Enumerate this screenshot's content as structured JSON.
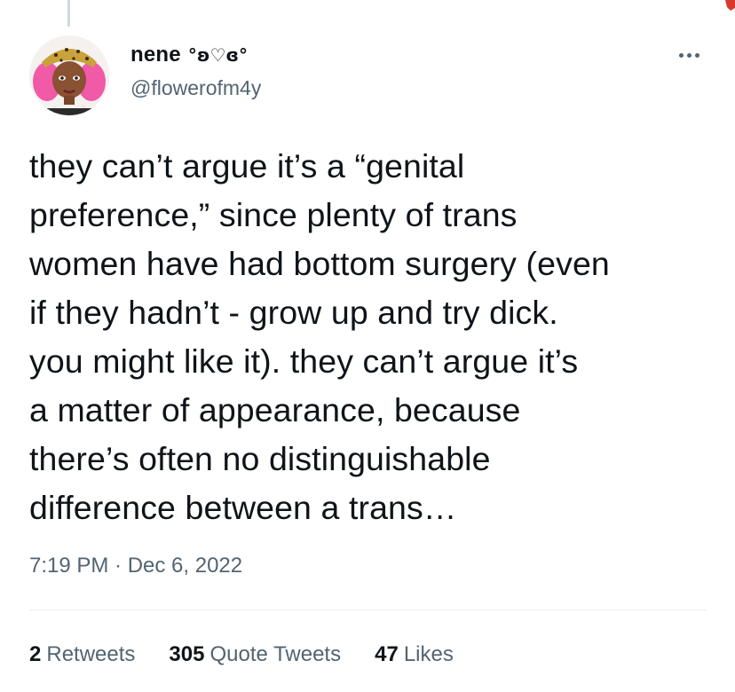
{
  "tweet": {
    "author": {
      "display_name": "nene",
      "name_decoration": "°ʚ♡ɞ°",
      "handle": "@flowerofm4y"
    },
    "text_lines": [
      "they can’t argue it’s a “genital",
      "preference,” since plenty of trans",
      "women have had bottom surgery (even",
      "if they hadn’t - grow up and try dick.",
      "you might like it). they can’t argue it’s",
      "a matter of appearance, because",
      "there’s often no distinguishable",
      "difference between a trans…"
    ],
    "timestamp": "7:19 PM · Dec 6, 2022",
    "stats": {
      "retweets_count": "2",
      "retweets_label": "Retweets",
      "quote_tweets_count": "305",
      "quote_tweets_label": "Quote Tweets",
      "likes_count": "47",
      "likes_label": "Likes"
    }
  },
  "icons": {
    "more": "more-horizontal-icon",
    "avatar": "avatar"
  },
  "colors": {
    "text_primary": "#0f1419",
    "text_secondary": "#536471",
    "divider": "#e6ecf0",
    "thread_line": "#cfd9de"
  }
}
